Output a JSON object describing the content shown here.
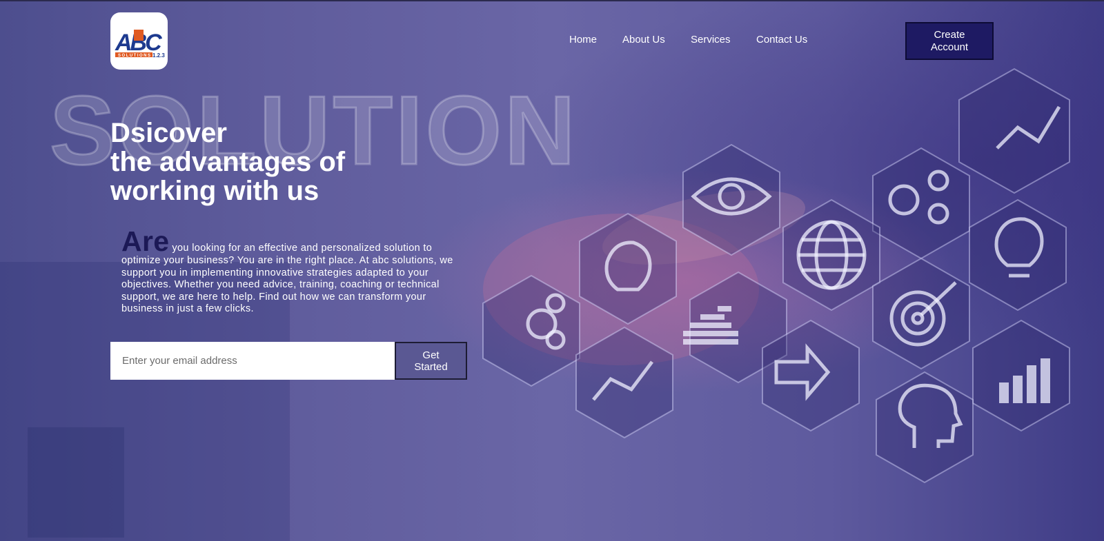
{
  "brand": {
    "logo_letters": "ABC",
    "logo_subtext": "SOLUTIONS",
    "logo_version": "1.2.3",
    "colors": {
      "blue": "#1d3a8f",
      "orange": "#e05a22"
    }
  },
  "nav": {
    "items": [
      "Home",
      "About Us",
      "Services",
      "Contact Us"
    ],
    "create_account_label": "Create Account"
  },
  "background": {
    "watermark_text": "SOLUTION",
    "icons": [
      "eye-icon",
      "gears-icon",
      "globe-icon",
      "trend-chart-icon",
      "lightbulb-icon",
      "target-icon",
      "arrows-icon",
      "bar-chart-icon",
      "head-gears-icon"
    ]
  },
  "hero": {
    "headline": [
      "Dsicover",
      "the advantages of",
      "working with us"
    ],
    "intro_big": "Are",
    "intro_text": "you looking for an effective and personalized solution to optimize your business? You are in the right place. At abc solutions, we support you in implementing innovative strategies adapted to your objectives. Whether you need advice, training, coaching or technical support, we are here to help. Find out how we can transform your business in just a few clicks."
  },
  "signup": {
    "email_placeholder": "Enter your email address",
    "button_label": "Get Started"
  },
  "colors": {
    "overlay": "#5d5b95",
    "button_dark": "#1e1a63",
    "intro_accent": "#1c1956"
  }
}
